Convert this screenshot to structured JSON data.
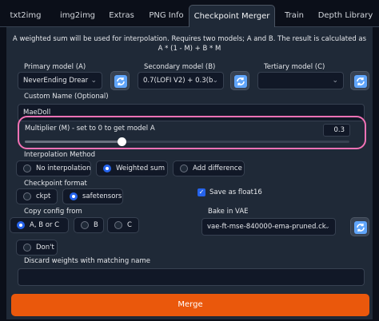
{
  "tabs": [
    "txt2img",
    "img2img",
    "Extras",
    "PNG Info",
    "Checkpoint Merger",
    "Train",
    "Depth Library"
  ],
  "description": "A weighted sum will be used for interpolation. Requires two models; A and B. The result is calculated as A * (1 - M) + B * M",
  "models": {
    "primary_label": "Primary model (A)",
    "primary_value": "NeverEnding Drear",
    "secondary_label": "Secondary model (B)",
    "secondary_value": "0.7(LOFI V2) + 0.3(b",
    "tertiary_label": "Tertiary model (C)",
    "tertiary_value": ""
  },
  "custom_name": {
    "label": "Custom Name (Optional)",
    "value": "MaeDoll"
  },
  "multiplier": {
    "label": "Multiplier (M) - set to 0 to get model A",
    "value": "0.3",
    "fraction": 0.3
  },
  "interpolation": {
    "label": "Interpolation Method",
    "options": [
      "No interpolation",
      "Weighted sum",
      "Add difference"
    ],
    "selected": "Weighted sum"
  },
  "checkpoint_format": {
    "label": "Checkpoint format",
    "options": [
      "ckpt",
      "safetensors"
    ],
    "selected": "safetensors"
  },
  "save_float16": {
    "label": "Save as float16",
    "checked": true
  },
  "copy_config": {
    "label": "Copy config from",
    "options": [
      "A, B or C",
      "B",
      "C",
      "Don't"
    ],
    "selected": "A, B or C"
  },
  "bake_vae": {
    "label": "Bake in VAE",
    "value": "vae-ft-mse-840000-ema-pruned.ck"
  },
  "discard_weights": {
    "label": "Discard weights with matching name",
    "value": ""
  },
  "merge_label": "Merge",
  "colors": {
    "accent": "#2563eb",
    "merge": "#ea580c",
    "highlight": "#f472b6"
  },
  "icons": {
    "refresh": "refresh-icon",
    "dropdown": "chevron-down-icon",
    "check": "check-icon"
  }
}
